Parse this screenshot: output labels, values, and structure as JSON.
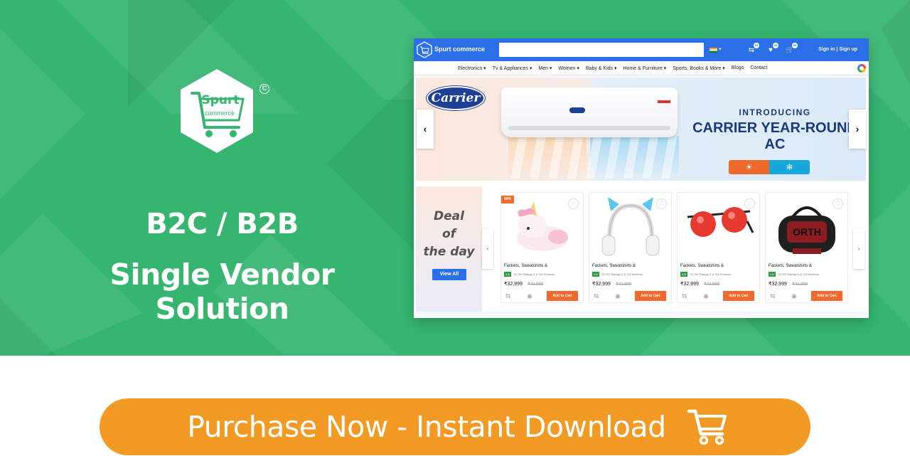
{
  "hero": {
    "logo_word_1": "Spurt",
    "logo_word_2": "commerce",
    "copyright_mark": "C",
    "title_line_1": "B2C / B2B",
    "title_line_2": "Single Vendor Solution"
  },
  "site": {
    "topbar": {
      "brand": "Spurt commerce",
      "search_value": "",
      "wishlist_count": "00",
      "cart_count": "00",
      "compare_count": "00",
      "sign_in": "Sign in | Sign up"
    },
    "nav": [
      "Electronics ▾",
      "Tv & Appliances ▾",
      "Men ▾",
      "Women ▾",
      "Baby & Kids ▾",
      "Home & Furniture ▾",
      "Sports, Books & More ▾",
      "Blogs",
      "Contact"
    ],
    "banner": {
      "logo": "Carrier",
      "headline_1": "INTRODUCING",
      "headline_2": "CARRIER YEAR-ROUND AC",
      "hot_icon": "☀",
      "cold_icon": "❄",
      "prev": "‹",
      "next": "›"
    },
    "deals": {
      "title": "Deal of the day",
      "view_all": "View All",
      "discount": "50%",
      "products": [
        {
          "name": "Fackets, Sweatshirts &",
          "rating": "4.6",
          "reviews": "76,700 Ratings & 6,740 Reviews",
          "price": "₹32,999",
          "mrp": "₹42,999",
          "cart": "Add to Cart",
          "image": "unicorn-plush"
        },
        {
          "name": "Fackets, Sweatshirts &",
          "rating": "4.6",
          "reviews": "76,700 Ratings & 6,740 Reviews",
          "price": "₹32,999",
          "mrp": "₹42,999",
          "cart": "Add to Cart",
          "image": "headphones"
        },
        {
          "name": "Fackets, Sweatshirts &",
          "rating": "4.6",
          "reviews": "76,700 Ratings & 6,740 Reviews",
          "price": "₹32,999",
          "mrp": "₹42,999",
          "cart": "Add to Cart",
          "image": "sunglasses"
        },
        {
          "name": "Fackets, Sweatshirts &",
          "rating": "4.6",
          "reviews": "76,700 Ratings & 6,740 Reviews",
          "price": "₹32,999",
          "mrp": "₹42,999",
          "cart": "Add to Cart",
          "image": "duffel-bag"
        }
      ]
    }
  },
  "cta": {
    "label": "Purchase Now - Instant Download",
    "icon": "cart-icon"
  },
  "colors": {
    "hero_green": "#35b56f",
    "site_blue": "#2b6fe8",
    "cta_orange": "#f39a24",
    "cart_orange": "#f26a2b"
  }
}
